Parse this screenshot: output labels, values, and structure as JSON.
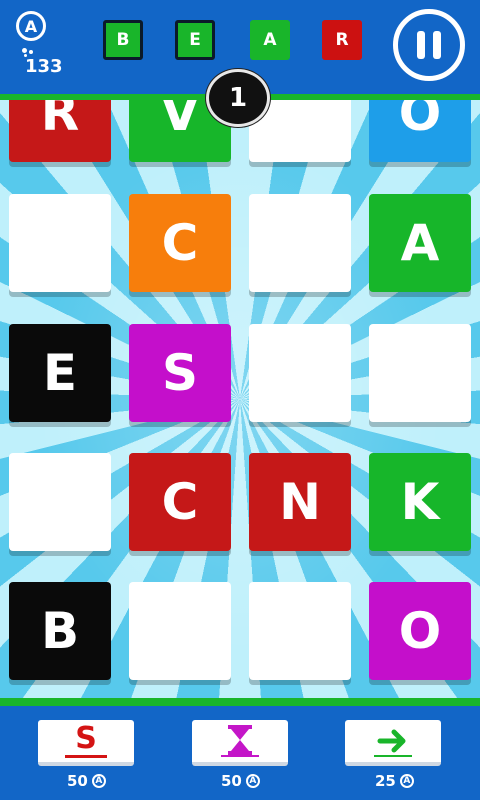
{
  "header": {
    "coin_symbol": "A",
    "coins": "133",
    "target_word": [
      {
        "letter": "B",
        "color": "#19b52a"
      },
      {
        "letter": "E",
        "color": "#19b52a"
      },
      {
        "letter": "A",
        "color": "#19b52a"
      },
      {
        "letter": "R",
        "color": "#cc1111"
      }
    ],
    "level": "1"
  },
  "board": {
    "rows": [
      [
        {
          "letter": "R",
          "color": "#c51818"
        },
        {
          "letter": "V",
          "color": "#17b62a"
        },
        {
          "letter": "",
          "color": "#ffffff"
        },
        {
          "letter": "O",
          "color": "#1e9ee9"
        }
      ],
      [
        {
          "letter": "",
          "color": "#ffffff"
        },
        {
          "letter": "C",
          "color": "#f77e0c"
        },
        {
          "letter": "",
          "color": "#ffffff"
        },
        {
          "letter": "A",
          "color": "#17b62a"
        }
      ],
      [
        {
          "letter": "E",
          "color": "#0a0a0a"
        },
        {
          "letter": "S",
          "color": "#c40fcb"
        },
        {
          "letter": "",
          "color": "#ffffff"
        },
        {
          "letter": "",
          "color": "#ffffff"
        }
      ],
      [
        {
          "letter": "",
          "color": "#ffffff"
        },
        {
          "letter": "C",
          "color": "#c51818"
        },
        {
          "letter": "N",
          "color": "#c51818"
        },
        {
          "letter": "K",
          "color": "#17b62a"
        }
      ],
      [
        {
          "letter": "B",
          "color": "#0a0a0a"
        },
        {
          "letter": "",
          "color": "#ffffff"
        },
        {
          "letter": "",
          "color": "#ffffff"
        },
        {
          "letter": "O",
          "color": "#c40fcb"
        }
      ]
    ]
  },
  "powerups": [
    {
      "icon": "letter-s-icon",
      "label": "S",
      "cost": "50"
    },
    {
      "icon": "hourglass-icon",
      "label": "",
      "cost": "50"
    },
    {
      "icon": "arrow-right-icon",
      "label": "",
      "cost": "25"
    }
  ]
}
